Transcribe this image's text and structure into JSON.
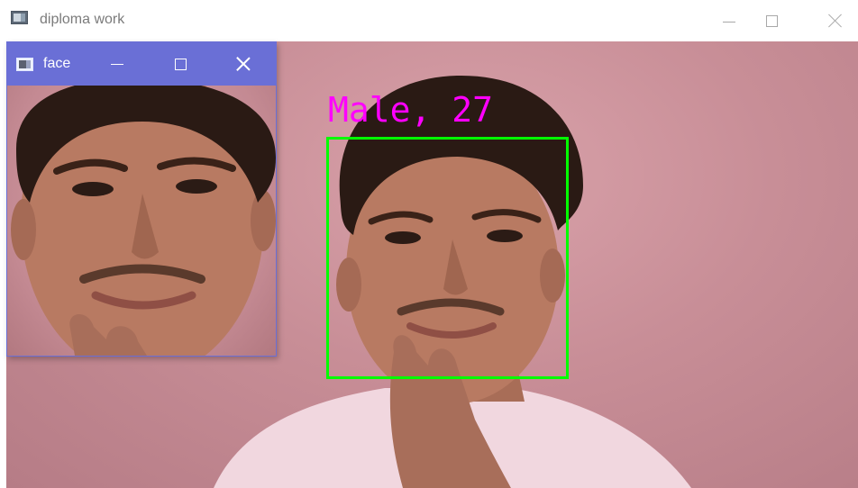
{
  "main_window": {
    "title": "diploma work",
    "icon": "app-window-icon",
    "controls": [
      "minimize-icon",
      "maximize-icon",
      "close-icon"
    ]
  },
  "detection": {
    "label": "Male, 27",
    "label_color": "#ff00ff",
    "box_color": "#00ff00"
  },
  "face_window": {
    "title": "face",
    "titlebar_color": "#6a6fd6",
    "icon": "app-window-icon",
    "controls": [
      "minimize-icon",
      "maximize-icon",
      "close-icon"
    ]
  },
  "colors": {
    "background_pink": "#c88e97",
    "shirt": "#f1d7df",
    "skin": "#b87a62",
    "hair": "#2a1a14"
  }
}
